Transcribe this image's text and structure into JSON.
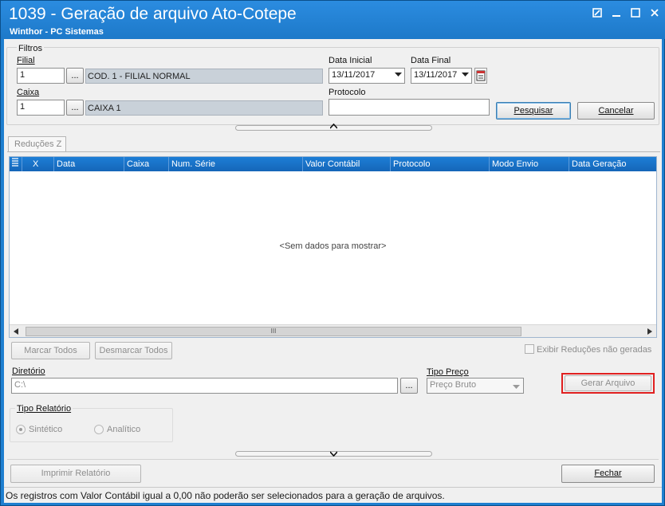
{
  "window": {
    "title": "1039 - Geração de arquivo Ato-Cotepe",
    "subtitle": "Winthor - PC Sistemas"
  },
  "filters": {
    "group_label": "Filtros",
    "filial_label": "Filial",
    "filial_value": "1",
    "filial_desc": "COD. 1 - FILIAL NORMAL",
    "caixa_label": "Caixa",
    "caixa_value": "1",
    "caixa_desc": "CAIXA 1",
    "lookup_label": "...",
    "data_inicial_label": "Data Inicial",
    "data_inicial_value": "13/11/2017",
    "data_final_label": "Data Final",
    "data_final_value": "13/11/2017",
    "protocolo_label": "Protocolo",
    "protocolo_value": "",
    "pesquisar_label": "Pesquisar",
    "cancelar_label": "Cancelar"
  },
  "tabs": [
    {
      "label": "Reduções Z"
    }
  ],
  "grid": {
    "columns": [
      "X",
      "Data",
      "Caixa",
      "Num. Série",
      "Valor Contábil",
      "Protocolo",
      "Modo Envio",
      "Data Geração"
    ],
    "empty_text": "<Sem dados para mostrar>",
    "scroll_grip": "III"
  },
  "actions": {
    "marcar_todos": "Marcar Todos",
    "desmarcar_todos": "Desmarcar Todos",
    "exibir_reducoes": "Exibir Reduções não geradas"
  },
  "diretorio": {
    "label": "Diretório",
    "value": "C:\\",
    "browse": "..."
  },
  "tipo_preco": {
    "label": "Tipo Preço",
    "selected": "Preço Bruto"
  },
  "gerar_arquivo": "Gerar Arquivo",
  "tipo_relatorio": {
    "label": "Tipo Relatório",
    "options": [
      "Sintético",
      "Analítico"
    ]
  },
  "imprimir_relatorio": "Imprimir Relatório",
  "fechar": "Fechar",
  "status_text": "Os registros com Valor Contábil igual a 0,00 não poderão ser selecionados para a geração de arquivos.",
  "colors": {
    "titlebar": "#1e7fd0",
    "grid_header": "#1a73c8",
    "highlight": "#e02020"
  }
}
